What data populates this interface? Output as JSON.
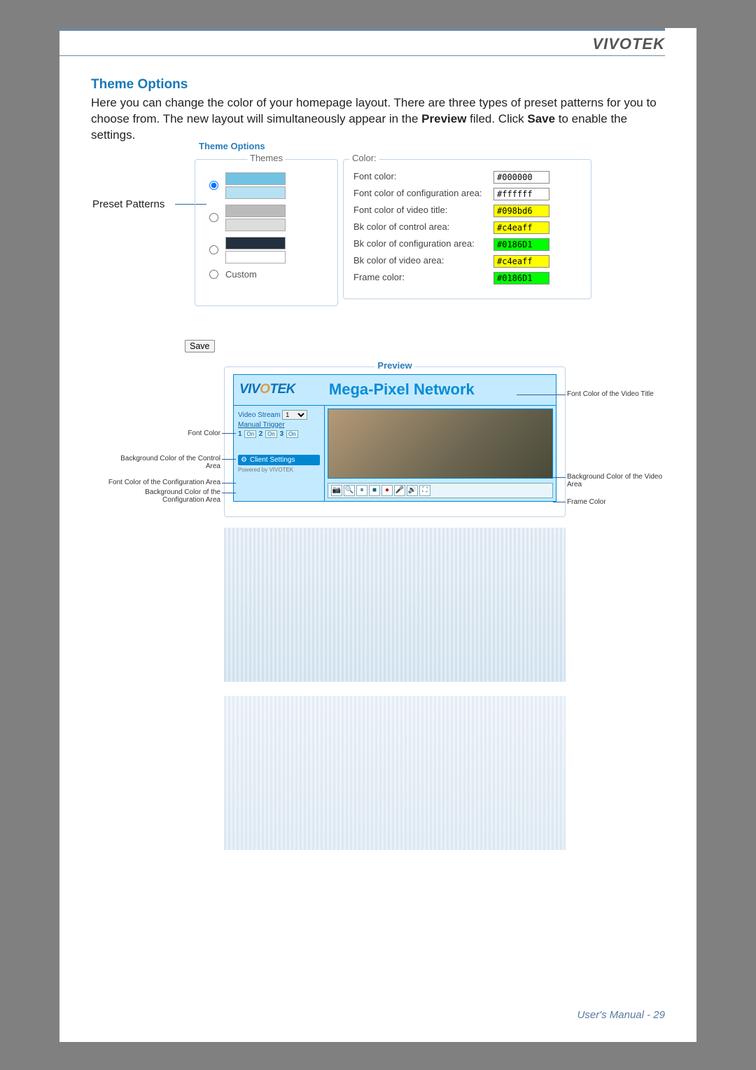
{
  "brand": "VIVOTEK",
  "heading": "Theme Options",
  "body_text": {
    "part1": "Here you can change the color of your homepage layout. There are three types of preset patterns for you to choose from. The new layout will simultaneously appear in the ",
    "bold1": "Preview",
    "part2": " filed. Click ",
    "bold2": "Save",
    "part3": " to enable the settings."
  },
  "labels": {
    "preset_patterns": "Preset Patterns",
    "theme_options_legend": "Theme Options",
    "themes_legend": "Themes",
    "color_legend": "Color:",
    "custom": "Custom",
    "preview_legend": "Preview"
  },
  "colors": [
    {
      "label": "Font color:",
      "value": "#000000",
      "hl": ""
    },
    {
      "label": "Font color of configuration area:",
      "value": "#ffffff",
      "hl": ""
    },
    {
      "label": "Font color of video title:",
      "value": "#098bd6",
      "hl": "hl1"
    },
    {
      "label": "Bk color of control area:",
      "value": "#c4eaff",
      "hl": "hl1"
    },
    {
      "label": "Bk color of configuration area:",
      "value": "#0186D1",
      "hl": "hl2"
    },
    {
      "label": "Bk color of video area:",
      "value": "#c4eaff",
      "hl": "hl1"
    },
    {
      "label": "Frame color:",
      "value": "#0186D1",
      "hl": "hl2"
    }
  ],
  "save_button": "Save",
  "preview": {
    "logo_text": "VIVOTEK",
    "video_title": "Mega-Pixel Network",
    "video_stream_label": "Video Stream",
    "video_stream_value": "1",
    "manual_trigger": "Manual Trigger",
    "triggers": [
      "1",
      "On",
      "2",
      "On",
      "3",
      "On"
    ],
    "client_settings": "Client Settings",
    "powered_by": "Powered by VIVOTEK"
  },
  "callouts": {
    "font_color": "Font Color",
    "bg_control": "Background Color of the Control Area",
    "font_config": "Font Color of the Configuration Area",
    "bg_config": "Background Color of the Configuration Area",
    "font_video_title": "Font Color of the Video Title",
    "bg_video": "Background Color of the Video Area",
    "frame_color": "Frame Color"
  },
  "footer": "User's Manual - 29"
}
